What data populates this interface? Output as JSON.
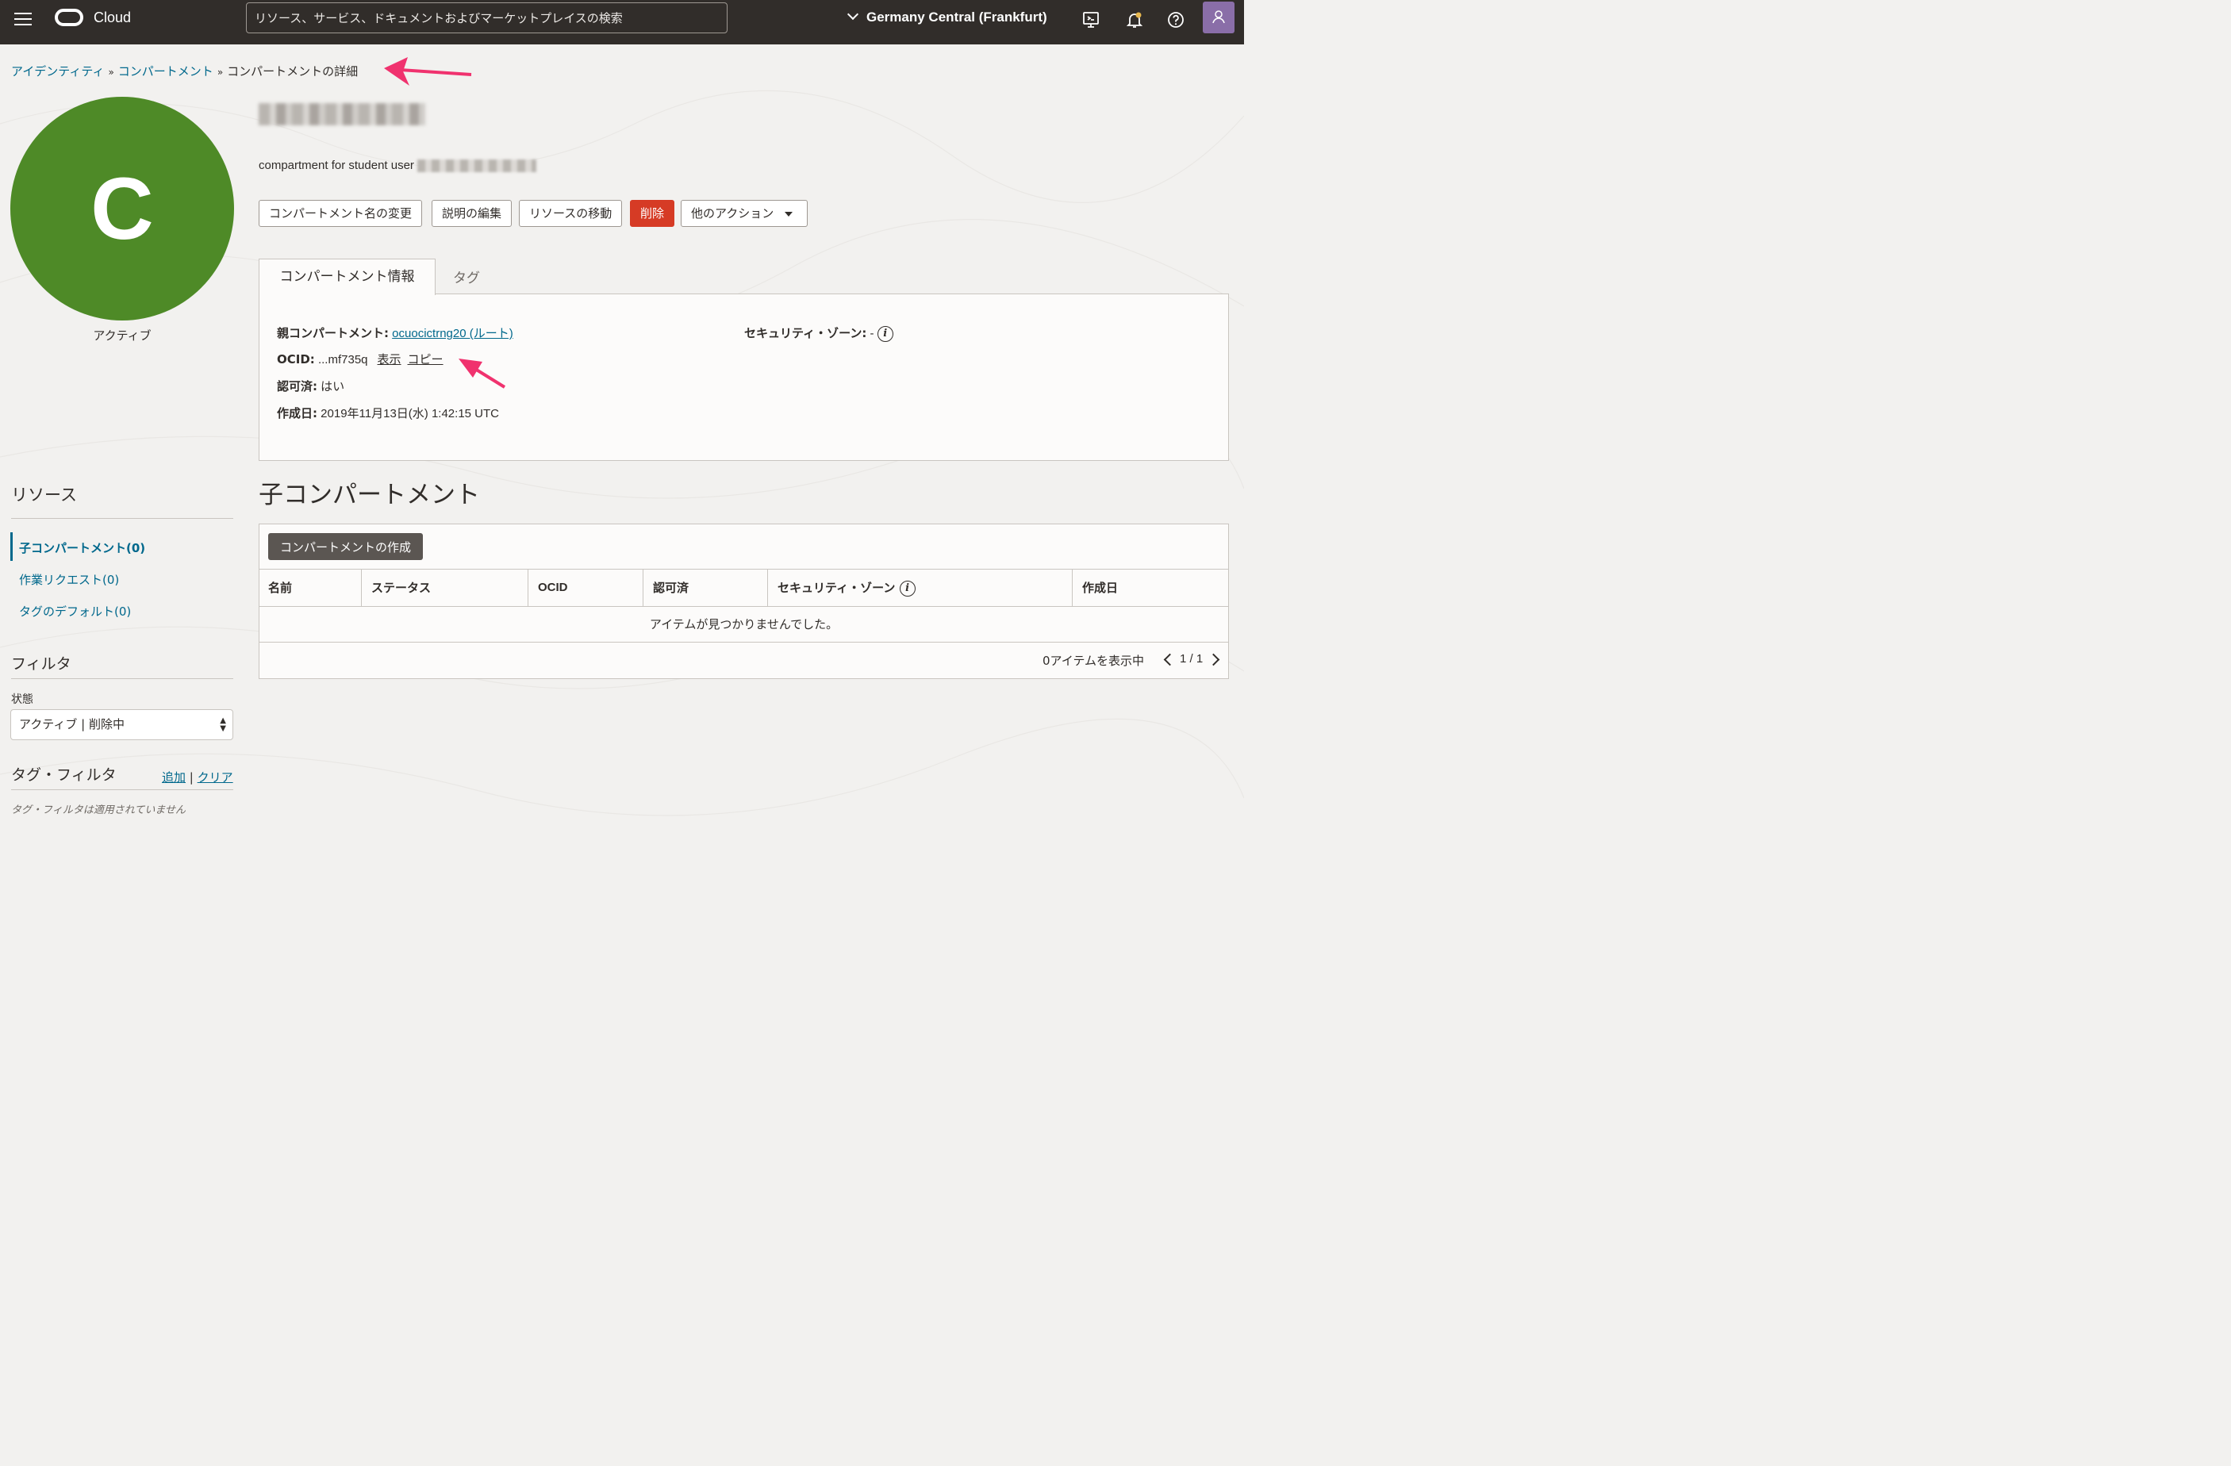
{
  "topbar": {
    "brand": "Cloud",
    "search_placeholder": "リソース、サービス、ドキュメントおよびマーケットプレイスの検索",
    "region": "Germany Central (Frankfurt)"
  },
  "breadcrumb": {
    "items": [
      "アイデンティティ",
      "コンパートメント"
    ],
    "separator": "»",
    "current": "コンパートメントの詳細"
  },
  "compartment": {
    "avatar_letter": "C",
    "avatar_color": "#4e8a27",
    "status": "アクティブ",
    "description_prefix": "compartment for student user"
  },
  "actions": {
    "rename": "コンパートメント名の変更",
    "edit_description": "説明の編集",
    "move_resource": "リソースの移動",
    "delete": "削除",
    "more_actions": "他のアクション"
  },
  "tabs": {
    "info": "コンパートメント情報",
    "tags": "タグ"
  },
  "info": {
    "parent_label": "親コンパートメント:",
    "parent_value": "ocuocictrng20 (ルート)",
    "ocid_label": "OCID:",
    "ocid_value": "...mf735q",
    "ocid_show": "表示",
    "ocid_copy": "コピー",
    "authorized_label": "認可済:",
    "authorized_value": "はい",
    "created_label": "作成日:",
    "created_value": "2019年11月13日(水) 1:42:15 UTC",
    "security_zone_label": "セキュリティ・ゾーン:",
    "security_zone_value": "-"
  },
  "child_section": {
    "title": "子コンパートメント",
    "create_button": "コンパートメントの作成",
    "columns": [
      "名前",
      "ステータス",
      "OCID",
      "認可済",
      "セキュリティ・ゾーン",
      "作成日"
    ],
    "empty_message": "アイテムが見つかりませんでした。",
    "items_shown": "0アイテムを表示中",
    "page": "1 / 1"
  },
  "sidebar": {
    "resources_heading": "リソース",
    "links": [
      "子コンパートメント(0)",
      "作業リクエスト(0)",
      "タグのデフォルト(0)"
    ],
    "filter_heading": "フィルタ",
    "state_label": "状態",
    "state_value": "アクティブ | 削除中",
    "tag_filter_heading": "タグ・フィルタ",
    "tag_filter_add": "追加",
    "tag_filter_clear": "クリア",
    "tag_filter_empty": "タグ・フィルタは適用されていません"
  },
  "colors": {
    "topbar": "#312d2a",
    "link": "#00688c",
    "danger": "#d63b25",
    "annotation_arrow": "#f0326e"
  }
}
